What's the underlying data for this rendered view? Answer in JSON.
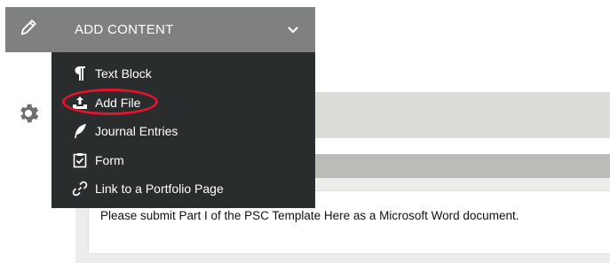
{
  "header": {
    "title": "ADD CONTENT"
  },
  "menu": {
    "items": [
      {
        "label": "Text Block",
        "icon": "paragraph-icon"
      },
      {
        "label": "Add File",
        "icon": "upload-icon"
      },
      {
        "label": "Journal Entries",
        "icon": "feather-icon"
      },
      {
        "label": "Form",
        "icon": "clipboard-check-icon"
      },
      {
        "label": "Link to a Portfolio Page",
        "icon": "link-icon"
      }
    ]
  },
  "content": {
    "instruction": "Please submit Part I of the PSC Template Here as a Microsoft Word document."
  },
  "colors": {
    "header_bg": "#7f8180",
    "menu_bg": "#2a2d2e",
    "annotation": "#e3132b"
  }
}
